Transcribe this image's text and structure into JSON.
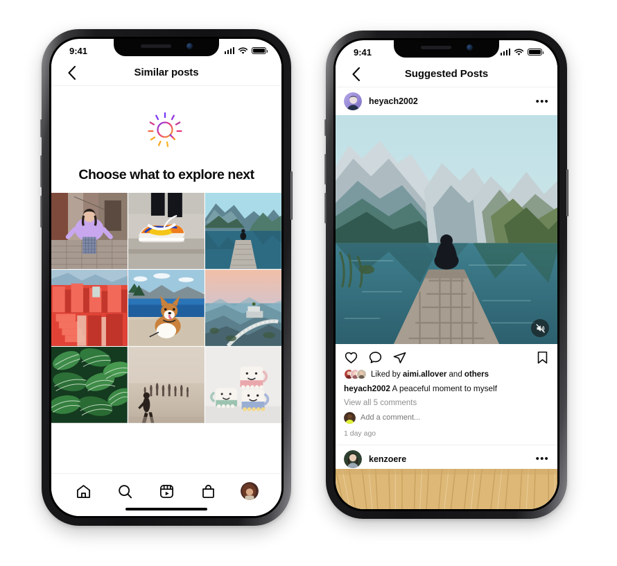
{
  "phone1": {
    "status": {
      "time": "9:41",
      "signal_icon": "signal-bars-icon",
      "wifi_icon": "wifi-icon",
      "battery_icon": "battery-icon"
    },
    "header": {
      "back_icon": "chevron-left-icon",
      "title": "Similar posts"
    },
    "hero": {
      "icon": "explore-search-sparkle-icon",
      "title": "Choose what to explore next"
    },
    "grid": [
      {
        "name": "grid-photo-street-portrait",
        "alt": "Woman in lilac sweater in alley"
      },
      {
        "name": "grid-photo-sneakers",
        "alt": "Orange and blue sneakers on curb"
      },
      {
        "name": "grid-photo-lake-dock",
        "alt": "Person sitting on dock by mountain lake"
      },
      {
        "name": "grid-photo-red-architecture",
        "alt": "Red Muralla Roja architecture"
      },
      {
        "name": "grid-photo-corgi",
        "alt": "Corgi dog by a blue lake"
      },
      {
        "name": "grid-photo-coast-road",
        "alt": "Winding coastal road viewpoint"
      },
      {
        "name": "grid-photo-leaves",
        "alt": "Striped green calathea leaves"
      },
      {
        "name": "grid-photo-beach-silhouette",
        "alt": "Silhouettes of people on hazy beach"
      },
      {
        "name": "grid-photo-mugs",
        "alt": "Ceramic mugs with faces"
      }
    ],
    "tabbar": [
      {
        "name": "tab-home",
        "icon": "home-icon"
      },
      {
        "name": "tab-search",
        "icon": "search-icon"
      },
      {
        "name": "tab-reels",
        "icon": "reels-icon"
      },
      {
        "name": "tab-shop",
        "icon": "shop-bag-icon"
      },
      {
        "name": "tab-profile",
        "icon": "profile-avatar-icon"
      }
    ]
  },
  "phone2": {
    "status": {
      "time": "9:41",
      "signal_icon": "signal-bars-icon",
      "wifi_icon": "wifi-icon",
      "battery_icon": "battery-icon"
    },
    "header": {
      "back_icon": "chevron-left-icon",
      "title": "Suggested Posts"
    },
    "post": {
      "username": "heyach2002",
      "more_icon": "more-options-icon",
      "media_alt": "Person sitting on a wooden dock facing a mountain lake",
      "mute_icon": "mute-icon",
      "actions": {
        "like_icon": "heart-icon",
        "comment_icon": "comment-bubble-icon",
        "share_icon": "share-paperplane-icon",
        "save_icon": "bookmark-icon"
      },
      "liked_by_prefix": "Liked by ",
      "liked_by_user": "aimi.allover",
      "liked_by_mid": " and ",
      "liked_by_suffix": "others",
      "caption_user": "heyach2002",
      "caption_text": " A peaceful moment to myself",
      "view_comments": "View all 5 comments",
      "add_comment_placeholder": "Add a comment...",
      "time_ago": "1 day ago"
    },
    "next_post": {
      "username": "kenzoere",
      "more_icon": "more-options-icon",
      "media_alt": "Light wood slat wall"
    }
  },
  "colors": {
    "accent_purple": "#7638FA",
    "accent_pink": "#E8397E",
    "accent_orange": "#F9A825",
    "text_primary": "#0b0b0b",
    "text_muted": "#8e8e8e",
    "divider": "#efefef"
  }
}
